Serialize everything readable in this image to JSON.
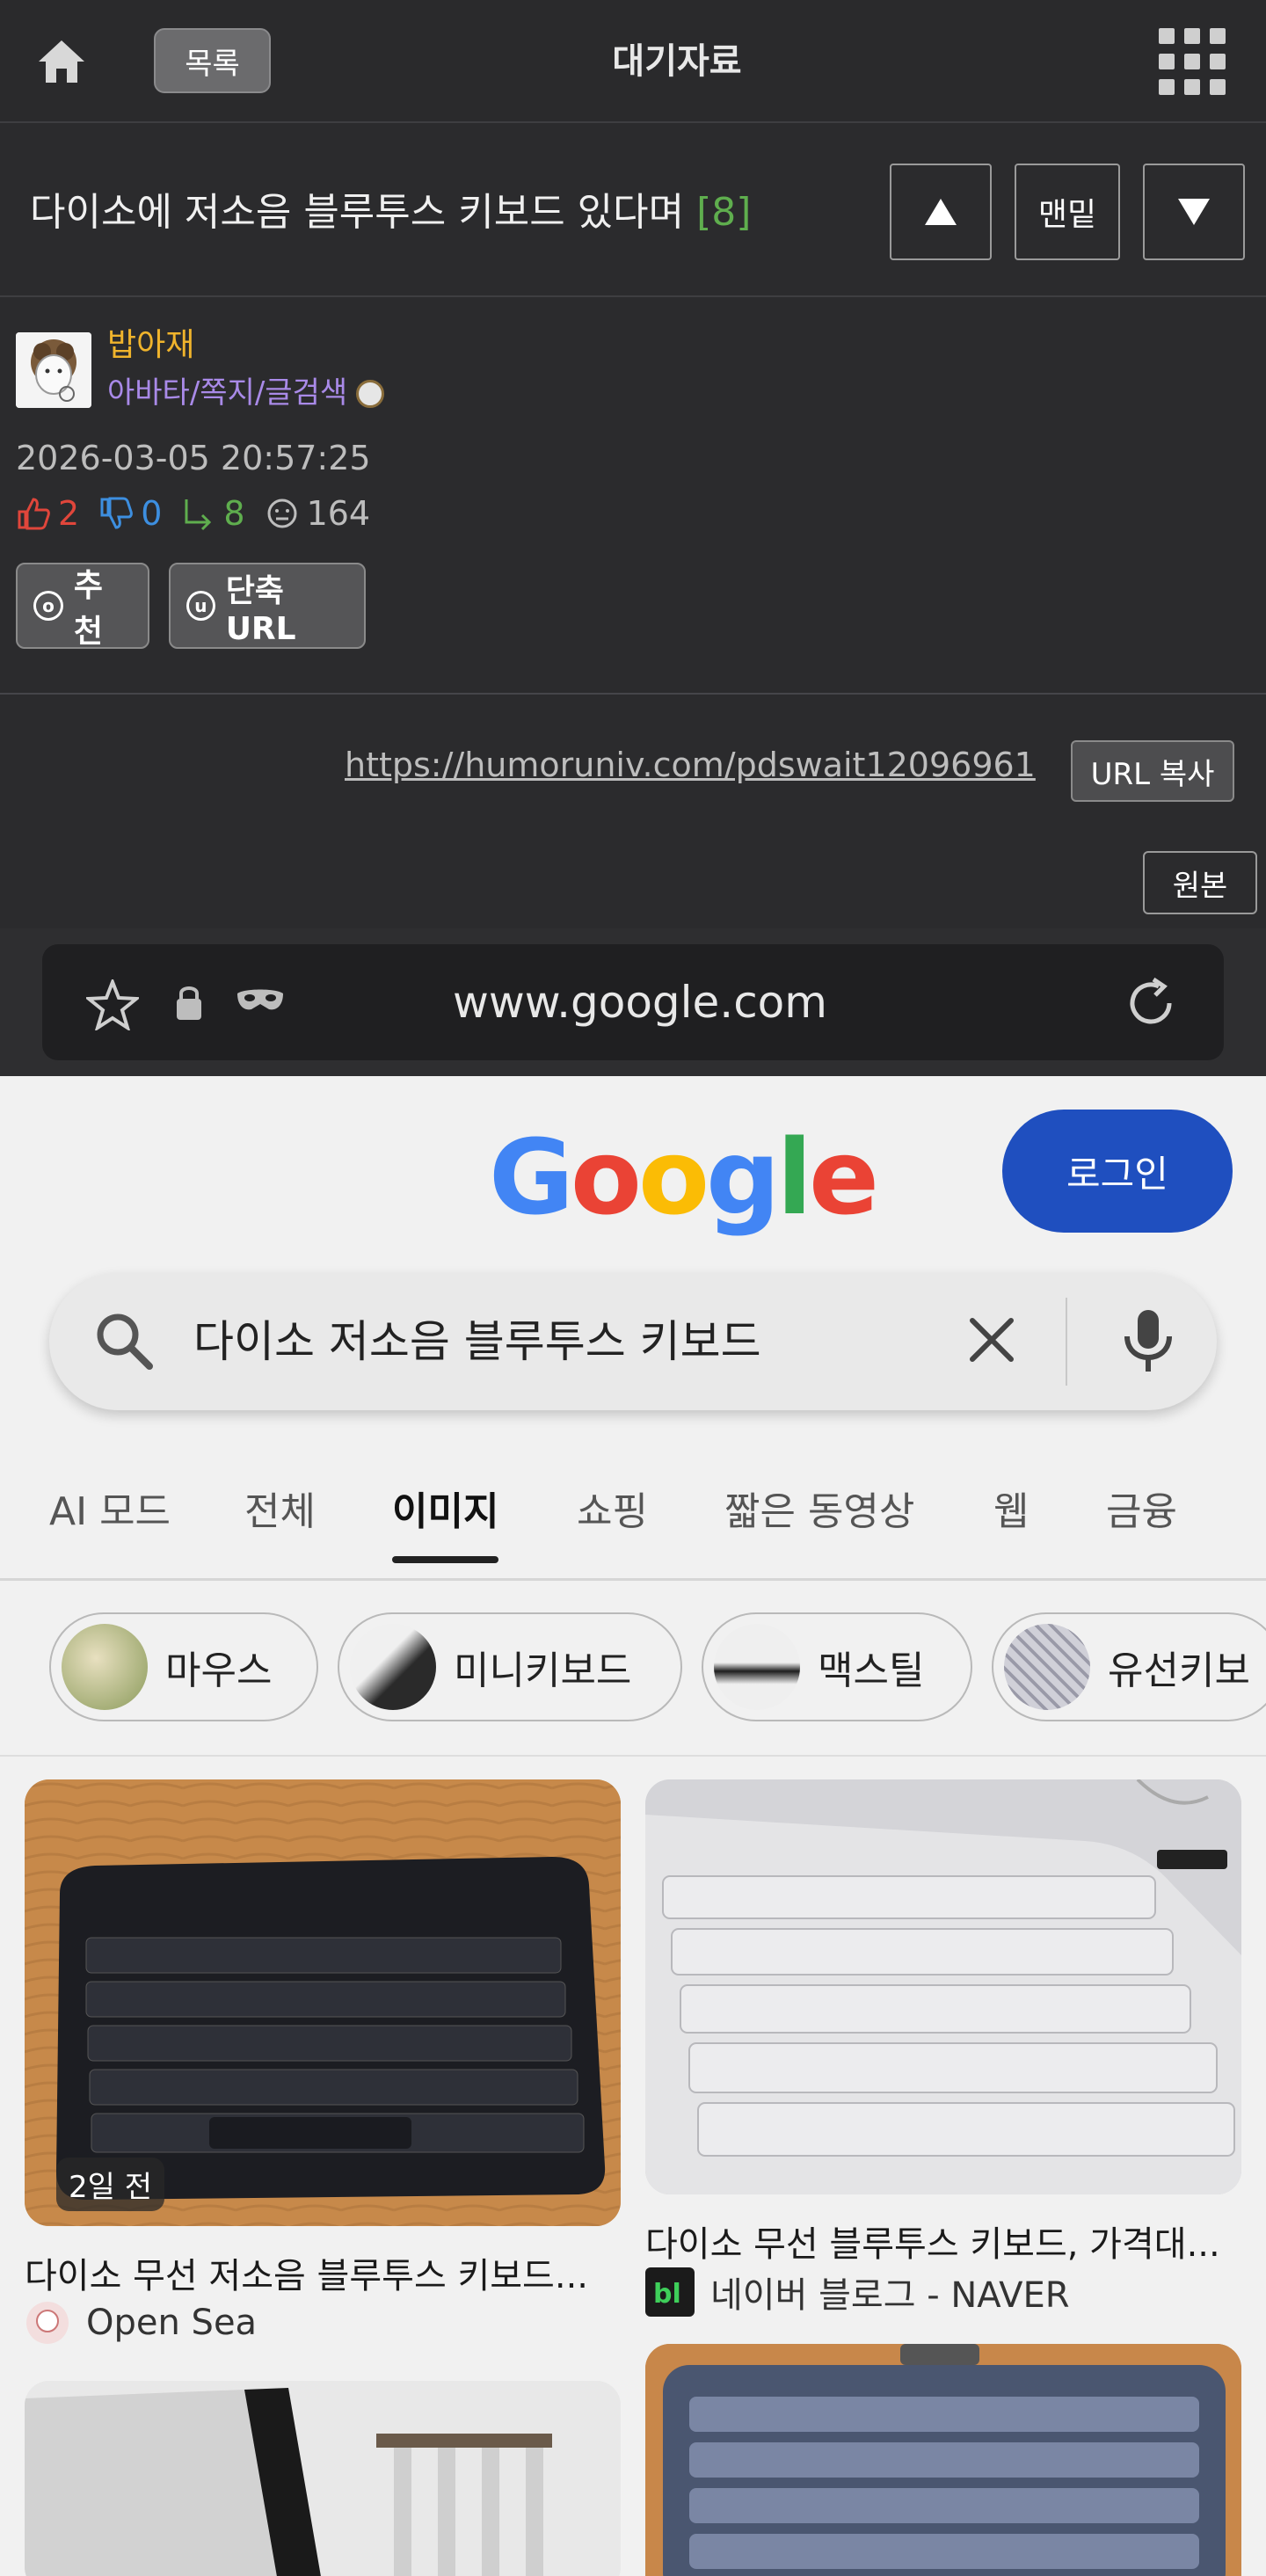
{
  "topbar": {
    "list_label": "목록",
    "board_title": "대기자료"
  },
  "post": {
    "title": "다이소에 저소음 블루투스 키보드 있다며",
    "comment_count": "[8]",
    "nav_bottom_label": "맨밑"
  },
  "author": {
    "nickname": "밥아재",
    "links": "아바타/쪽지/글검색",
    "date": "2026-03-05 20:57:25",
    "stats": {
      "up": "2",
      "down": "0",
      "replies": "8",
      "views": "164"
    },
    "recommend_label": "추천",
    "short_url_label": "단축URL"
  },
  "url_row": {
    "url": "https://humoruniv.com/pdswait12096961",
    "copy_label": "URL 복사",
    "original_label": "원본"
  },
  "embedded": {
    "browser_url": "www.google.com",
    "login_label": "로그인",
    "search_query": "다이소 저소음 블루투스 키보드",
    "tabs": [
      "AI 모드",
      "전체",
      "이미지",
      "쇼핑",
      "짧은 동영상",
      "웹",
      "금융"
    ],
    "active_tab": "이미지",
    "chips": [
      "마우스",
      "미니키보드",
      "맥스틸",
      "유선키보"
    ],
    "results": [
      {
        "badge": "2일 전",
        "caption": "다이소 무선 저소음 블루투스 키보드...",
        "source": "Open Sea"
      },
      {
        "caption": "다이소 무선 블루투스 키보드, 가격대...",
        "source": "네이버 블로그 - NAVER"
      }
    ]
  },
  "colors": {
    "background": "#2b2b2d",
    "nickname": "#f0b42c",
    "links": "#a98ae8",
    "comment_count": "#5fae4e",
    "vote_up": "#e0463b",
    "vote_down": "#3d8fe0",
    "login_button": "#1f4fbf"
  }
}
